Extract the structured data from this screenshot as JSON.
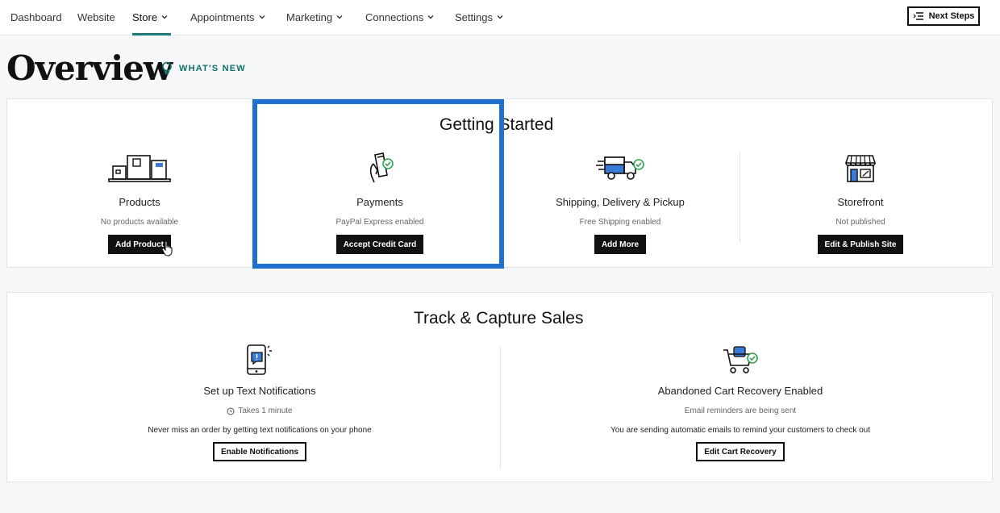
{
  "nav": {
    "items": [
      {
        "label": "Dashboard",
        "dropdown": false
      },
      {
        "label": "Website",
        "dropdown": false
      },
      {
        "label": "Store",
        "dropdown": true,
        "active": true
      },
      {
        "label": "Appointments",
        "dropdown": true
      },
      {
        "label": "Marketing",
        "dropdown": true
      },
      {
        "label": "Connections",
        "dropdown": true
      },
      {
        "label": "Settings",
        "dropdown": true
      }
    ],
    "next_steps_label": "Next Steps"
  },
  "page": {
    "title": "Overview",
    "whats_new": "WHAT'S NEW"
  },
  "getting_started": {
    "title": "Getting Started",
    "items": [
      {
        "icon": "packages-icon",
        "label": "Products",
        "status": "No products available",
        "button": "Add Product"
      },
      {
        "icon": "payment-card-icon",
        "label": "Payments",
        "status": "PayPal Express enabled",
        "button": "Accept Credit Card"
      },
      {
        "icon": "delivery-truck-icon",
        "label": "Shipping, Delivery & Pickup",
        "status": "Free Shipping enabled",
        "button": "Add More"
      },
      {
        "icon": "storefront-icon",
        "label": "Storefront",
        "status": "Not published",
        "button": "Edit & Publish Site"
      }
    ]
  },
  "track_capture": {
    "title": "Track & Capture Sales",
    "items": [
      {
        "icon": "phone-notification-icon",
        "label": "Set up Text Notifications",
        "status": "Takes 1 minute",
        "description": "Never miss an order by getting text notifications on your phone",
        "button": "Enable Notifications"
      },
      {
        "icon": "cart-check-icon",
        "label": "Abandoned Cart Recovery Enabled",
        "status": "Email reminders are being sent",
        "description": "You are sending automatic emails to remind your customers to check out",
        "button": "Edit Cart Recovery"
      }
    ]
  },
  "colors": {
    "accent": "#1b7d7a",
    "highlight": "#1f6fd1",
    "check": "#2ea44f"
  }
}
